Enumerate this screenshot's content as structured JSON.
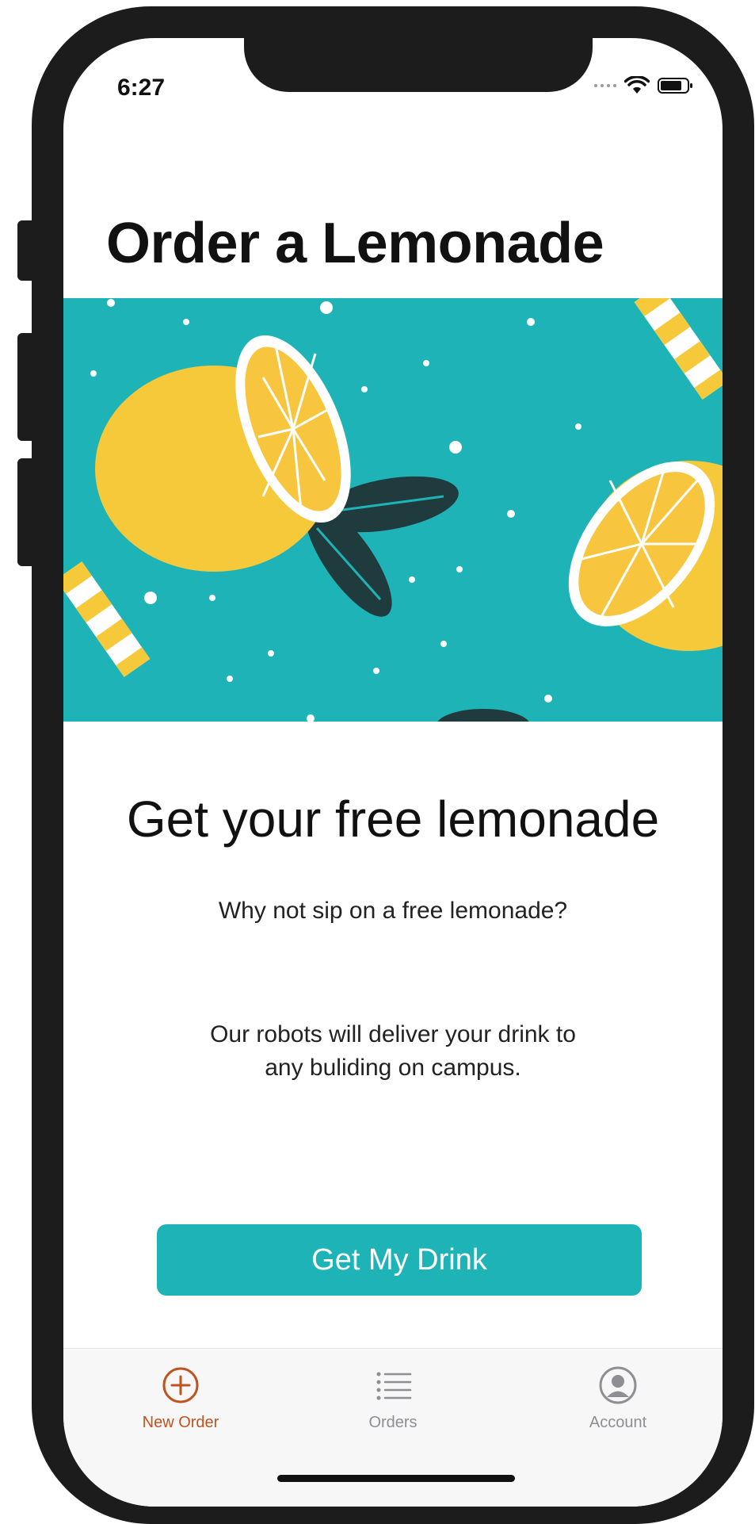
{
  "status_bar": {
    "time": "6:27"
  },
  "page": {
    "title": "Order a Lemonade",
    "headline": "Get your free lemonade",
    "subtext": "Why not sip on a free lemonade?",
    "description_line1": "Our robots will deliver your drink to",
    "description_line2": "any buliding on campus.",
    "cta_label": "Get My Drink"
  },
  "tab_bar": {
    "items": [
      {
        "label": "New Order",
        "icon": "plus-circle-icon",
        "active": true
      },
      {
        "label": "Orders",
        "icon": "list-icon",
        "active": false
      },
      {
        "label": "Account",
        "icon": "user-circle-icon",
        "active": false
      }
    ]
  },
  "colors": {
    "accent_teal": "#1eb3b6",
    "active_tab": "#c0531f",
    "inactive_tab": "#8e8e93",
    "lemon_yellow": "#f5c93a",
    "leaf_dark": "#1f3b3d"
  }
}
